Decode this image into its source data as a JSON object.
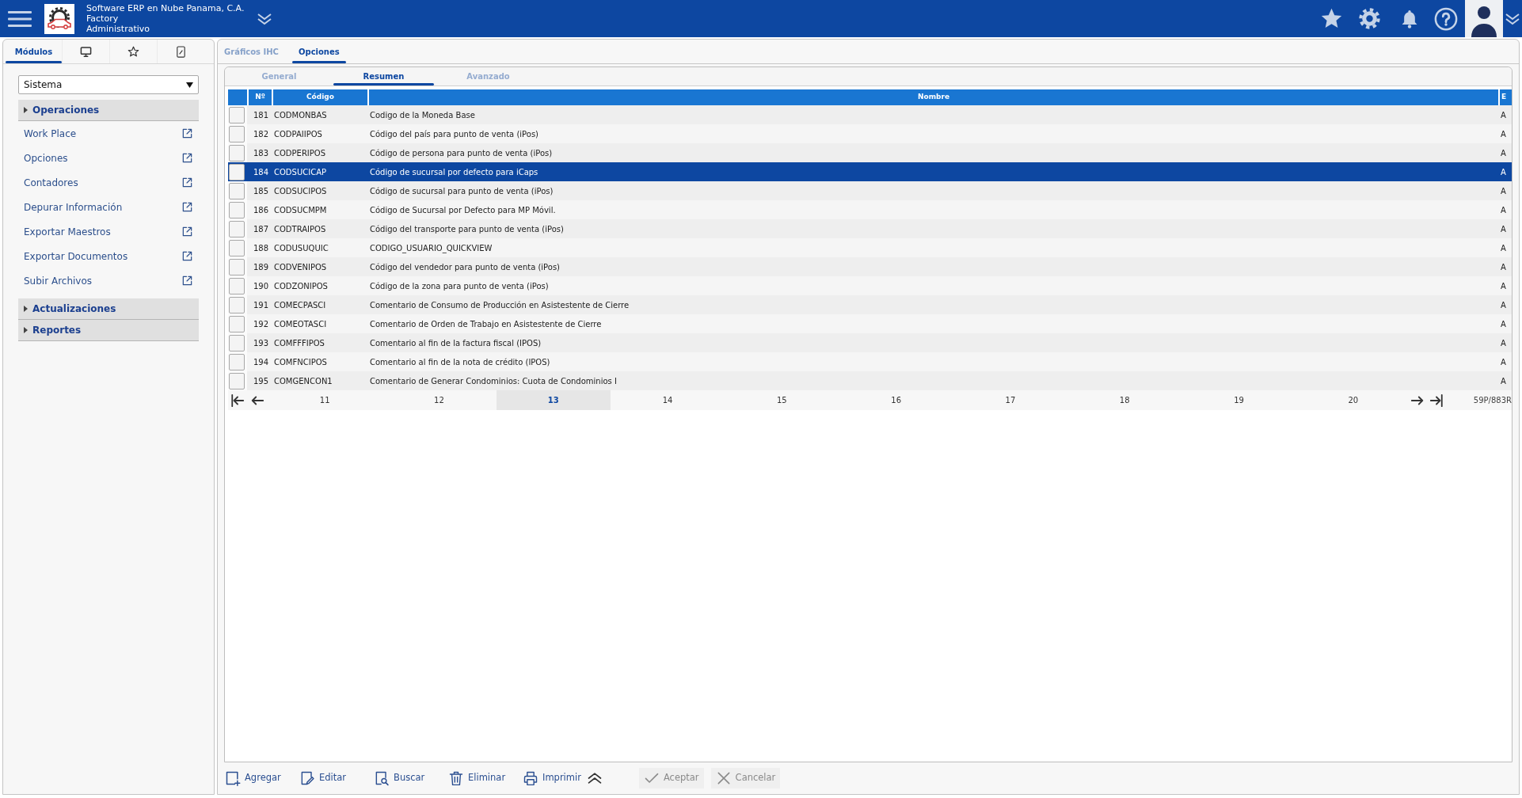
{
  "topbar": {
    "company": "Software ERP en Nube Panama, C.A.",
    "product": "Factory",
    "module": "Administrativo"
  },
  "sidebar": {
    "tabs": [
      {
        "label": "Módulos",
        "selected": true
      },
      {
        "selected": false
      },
      {
        "selected": false
      },
      {
        "selected": false
      }
    ],
    "module_select": {
      "value": "Sistema"
    },
    "menu": [
      {
        "label": "Operaciones",
        "children": [
          {
            "label": "Work Place"
          },
          {
            "label": "Opciones"
          },
          {
            "label": "Contadores"
          },
          {
            "label": "Depurar Información"
          },
          {
            "label": "Exportar Maestros"
          },
          {
            "label": "Exportar Documentos"
          },
          {
            "label": "Subir Archivos"
          }
        ]
      },
      {
        "label": "Actualizaciones"
      },
      {
        "label": "Reportes"
      }
    ]
  },
  "tabs": [
    {
      "label": "Gráficos IHC",
      "selected": false
    },
    {
      "label": "Opciones",
      "selected": true
    }
  ],
  "subtabs": [
    {
      "label": "General",
      "selected": false
    },
    {
      "label": "Resumen",
      "selected": true
    },
    {
      "label": "Avanzado",
      "selected": false
    }
  ],
  "table": {
    "columns": [
      "Nº",
      "Código",
      "Nombre",
      "E"
    ],
    "rows": [
      {
        "cells": [
          "181",
          "CODMONBAS",
          "Codigo de la Moneda Base",
          "A"
        ],
        "checked": false,
        "selected": false
      },
      {
        "cells": [
          "182",
          "CODPAIIPOS",
          "Código del país para punto de venta (iPos)",
          "A"
        ],
        "checked": false,
        "selected": false
      },
      {
        "cells": [
          "183",
          "CODPERIPOS",
          "Código de persona para punto de venta (iPos)",
          "A"
        ],
        "checked": false,
        "selected": false
      },
      {
        "cells": [
          "184",
          "CODSUCICAP",
          "Código de sucursal por defecto para iCaps",
          "A"
        ],
        "checked": false,
        "selected": true
      },
      {
        "cells": [
          "185",
          "CODSUCIPOS",
          "Código de sucursal para punto de venta (iPos)",
          "A"
        ],
        "checked": false,
        "selected": false
      },
      {
        "cells": [
          "186",
          "CODSUCMPM",
          "Código de Sucursal por Defecto para MP Móvil.",
          "A"
        ],
        "checked": false,
        "selected": false
      },
      {
        "cells": [
          "187",
          "CODTRAIPOS",
          "Código del transporte para punto de venta (iPos)",
          "A"
        ],
        "checked": false,
        "selected": false
      },
      {
        "cells": [
          "188",
          "CODUSUQUIC",
          "CODIGO_USUARIO_QUICKVIEW",
          "A"
        ],
        "checked": false,
        "selected": false
      },
      {
        "cells": [
          "189",
          "CODVENIPOS",
          "Código del vendedor para punto de venta (iPos)",
          "A"
        ],
        "checked": false,
        "selected": false
      },
      {
        "cells": [
          "190",
          "CODZONIPOS",
          "Código de la zona para punto de venta (iPos)",
          "A"
        ],
        "checked": false,
        "selected": false
      },
      {
        "cells": [
          "191",
          "COMECPASCI",
          "Comentario de Consumo de Producción en Asistestente de Cierre",
          "A"
        ],
        "checked": false,
        "selected": false
      },
      {
        "cells": [
          "192",
          "COMEOTASCI",
          "Comentario de Orden de Trabajo en Asistestente de Cierre",
          "A"
        ],
        "checked": false,
        "selected": false
      },
      {
        "cells": [
          "193",
          "COMFFFIPOS",
          "Comentario al fin de la factura fiscal (IPOS)",
          "A"
        ],
        "checked": false,
        "selected": false
      },
      {
        "cells": [
          "194",
          "COMFNCIPOS",
          "Comentario al fin de la nota de crédito (IPOS)",
          "A"
        ],
        "checked": false,
        "selected": false
      },
      {
        "cells": [
          "195",
          "COMGENCON1",
          "Comentario de Generar Condominios: Cuota de Condominios I",
          "A"
        ],
        "checked": false,
        "selected": false
      }
    ]
  },
  "pager": {
    "pages": [
      {
        "label": "11",
        "selected": false
      },
      {
        "label": "12",
        "selected": false
      },
      {
        "label": "13",
        "selected": true
      },
      {
        "label": "14",
        "selected": false
      },
      {
        "label": "15",
        "selected": false
      },
      {
        "label": "16",
        "selected": false
      },
      {
        "label": "17",
        "selected": false
      },
      {
        "label": "18",
        "selected": false
      },
      {
        "label": "19",
        "selected": false
      },
      {
        "label": "20",
        "selected": false
      }
    ],
    "summary": "59P/883R"
  },
  "toolbar": {
    "tools": [
      {
        "label": "Agregar",
        "disabled": false
      },
      {
        "label": "Editar",
        "disabled": false
      },
      {
        "label": "Buscar",
        "disabled": false
      },
      {
        "label": "Eliminar",
        "disabled": false
      },
      {
        "label": "Imprimir",
        "disabled": false
      }
    ],
    "actions": [
      {
        "label": "Aceptar",
        "disabled": true
      },
      {
        "label": "Cancelar",
        "disabled": true
      }
    ]
  }
}
